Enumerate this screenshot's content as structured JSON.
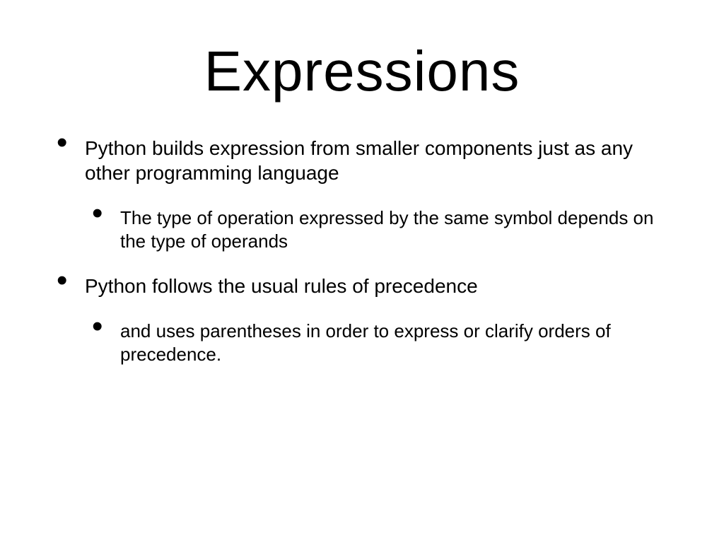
{
  "title": "Expressions",
  "bullets": [
    {
      "text": "Python builds expression from smaller components just as any other programming language",
      "sub": [
        {
          "text": "The type of operation expressed by the same symbol depends on the type of operands"
        }
      ]
    },
    {
      "text": "Python follows the usual rules of precedence",
      "sub": [
        {
          "text": "and uses parentheses in order to express or clarify orders of precedence."
        }
      ]
    }
  ]
}
